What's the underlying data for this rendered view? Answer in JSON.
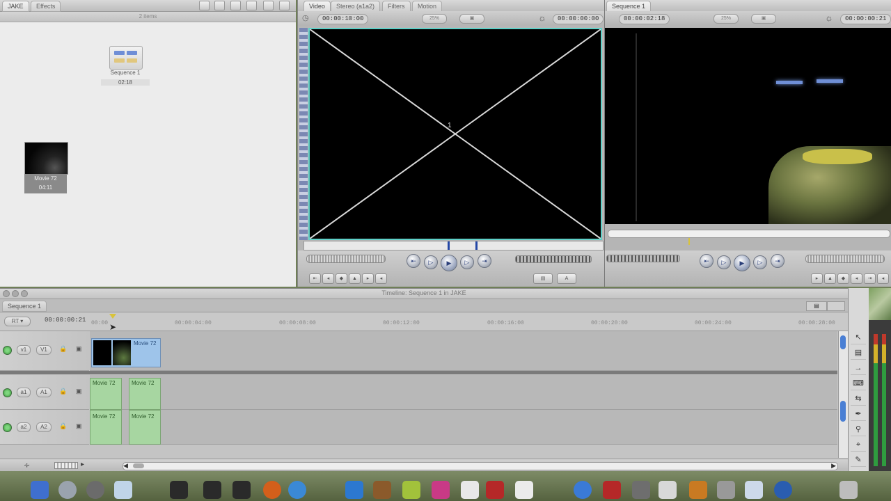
{
  "browser": {
    "tabs": [
      "JAKE",
      "Effects"
    ],
    "item_count": "2 items",
    "items": [
      {
        "name": "Sequence 1",
        "duration": "02:18"
      },
      {
        "name": "Movie 72",
        "duration": "04:11"
      }
    ]
  },
  "viewer": {
    "tabs": [
      "Video",
      "Stereo (a1a2)",
      "Filters",
      "Motion"
    ],
    "duration_tc": "00:00:10:00",
    "zoom": "25%",
    "current_tc": "00:00:00:00",
    "slug_marker": "1"
  },
  "canvas": {
    "tab": "Sequence 1",
    "duration_tc": "00:00:02:18",
    "zoom": "25%",
    "current_tc": "00:00:00:21"
  },
  "timeline": {
    "title": "Timeline: Sequence 1 in JAKE",
    "tab": "Sequence 1",
    "rt_label": "RT",
    "current_tc": "00:00:00:21",
    "ruler": [
      "00:00",
      "00:00:04:00",
      "00:00:08:00",
      "00:00:12:00",
      "00:00:16:00",
      "00:00:20:00",
      "00:00:24:00",
      "00:00:28:00"
    ],
    "tracks": [
      {
        "source": "v1",
        "dest": "V1"
      },
      {
        "source": "a1",
        "dest": "A1"
      },
      {
        "source": "a2",
        "dest": "A2"
      }
    ],
    "clip_name": "Movie 72"
  },
  "colors": {
    "accent_selection": "#5fd0c8",
    "video_clip": "#9ec4ea",
    "audio_clip": "#a7d6a1",
    "track_enabled": "#4caf50"
  },
  "icons": [
    "selection-arrow-icon",
    "edit-select-icon",
    "track-select-icon",
    "roll-icon",
    "slip-icon",
    "razor-icon",
    "zoom-icon",
    "crop-icon",
    "pen-icon",
    "hand-icon"
  ]
}
